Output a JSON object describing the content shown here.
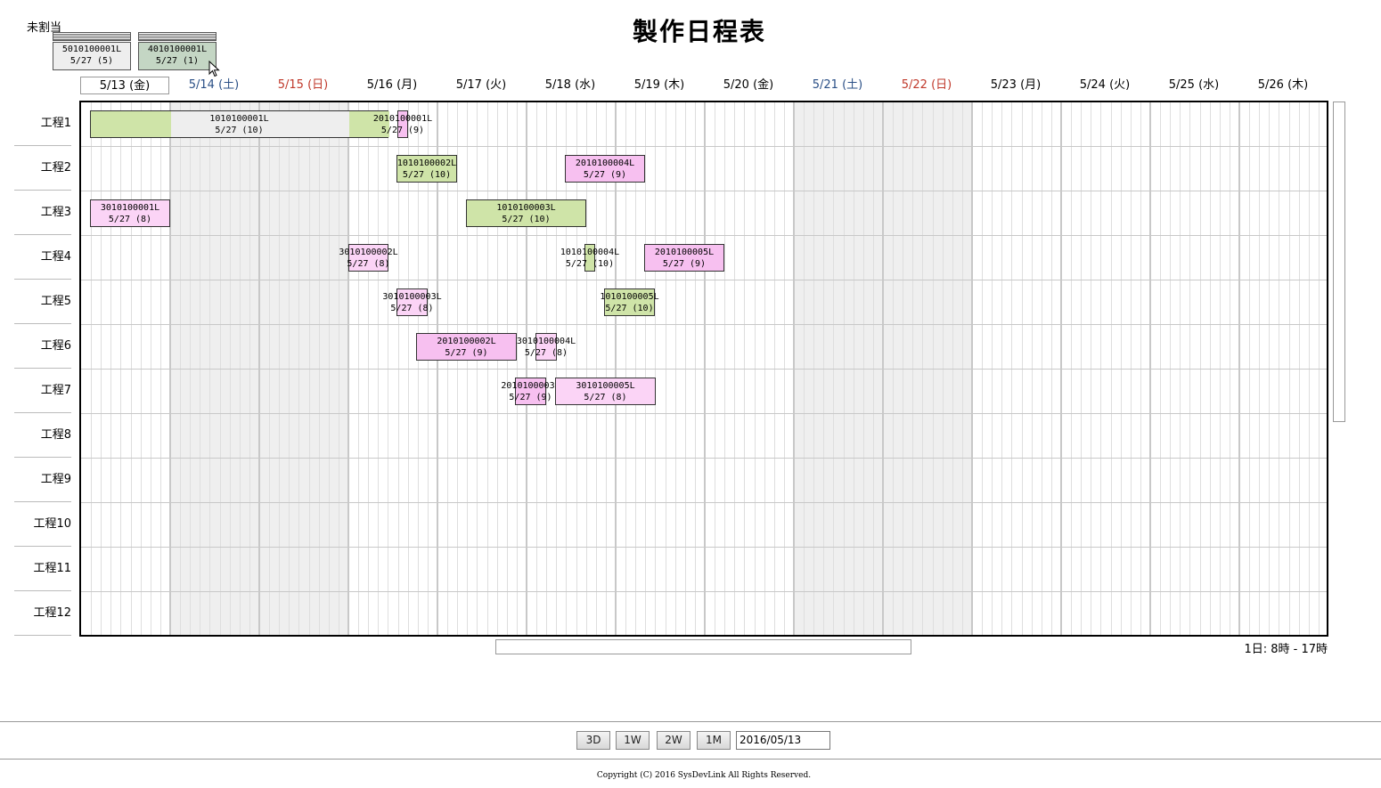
{
  "title": "製作日程表",
  "unassigned": {
    "label": "未割当",
    "cards": [
      {
        "id": "5010100001L",
        "date": "5/27 (5)",
        "color": "#eeeeee"
      },
      {
        "id": "4010100001L",
        "date": "5/27 (1)",
        "color": "#c4d6c4"
      }
    ]
  },
  "days": [
    {
      "label": "5/13 (金)",
      "color": "#000000",
      "selected": true
    },
    {
      "label": "5/14 (土)",
      "color": "#2a4f86"
    },
    {
      "label": "5/15 (日)",
      "color": "#c0392b"
    },
    {
      "label": "5/16 (月)",
      "color": "#000000"
    },
    {
      "label": "5/17 (火)",
      "color": "#000000"
    },
    {
      "label": "5/18 (水)",
      "color": "#000000"
    },
    {
      "label": "5/19 (木)",
      "color": "#000000"
    },
    {
      "label": "5/20 (金)",
      "color": "#000000"
    },
    {
      "label": "5/21 (土)",
      "color": "#2a4f86"
    },
    {
      "label": "5/22 (日)",
      "color": "#c0392b"
    },
    {
      "label": "5/23 (月)",
      "color": "#000000"
    },
    {
      "label": "5/24 (火)",
      "color": "#000000"
    },
    {
      "label": "5/25 (水)",
      "color": "#000000"
    },
    {
      "label": "5/26 (木)",
      "color": "#000000"
    }
  ],
  "rows": [
    "工程1",
    "工程2",
    "工程3",
    "工程4",
    "工程5",
    "工程6",
    "工程7",
    "工程8",
    "工程9",
    "工程10",
    "工程11",
    "工程12"
  ],
  "jobs": [
    {
      "row": 0,
      "id": "1010100001L",
      "date": "5/27 (10)",
      "start": 0.1,
      "duration": 3.35,
      "color": "grey",
      "progress_segments": [
        [
          0,
          0.9
        ],
        [
          2.9,
          3.35
        ]
      ]
    },
    {
      "row": 0,
      "id": "2010100001L",
      "date": "5/27 (9)",
      "start": 3.55,
      "duration": 0.12,
      "color": "pink"
    },
    {
      "row": 1,
      "id": "1010100002L",
      "date": "5/27 (10)",
      "start": 3.54,
      "duration": 0.68,
      "color": "green"
    },
    {
      "row": 1,
      "id": "2010100004L",
      "date": "5/27 (9)",
      "start": 5.43,
      "duration": 0.9,
      "color": "pink"
    },
    {
      "row": 2,
      "id": "3010100001L",
      "date": "5/27 (8)",
      "start": 0.1,
      "duration": 0.9,
      "color": "pink2"
    },
    {
      "row": 2,
      "id": "1010100003L",
      "date": "5/27 (10)",
      "start": 4.32,
      "duration": 1.35,
      "color": "green"
    },
    {
      "row": 3,
      "id": "3010100002L",
      "date": "5/27 (8)",
      "start": 3.0,
      "duration": 0.45,
      "color": "pink2"
    },
    {
      "row": 3,
      "id": "1010100004L",
      "date": "5/27 (10)",
      "start": 5.65,
      "duration": 0.12,
      "color": "green"
    },
    {
      "row": 3,
      "id": "2010100005L",
      "date": "5/27 (9)",
      "start": 6.32,
      "duration": 0.9,
      "color": "pink"
    },
    {
      "row": 4,
      "id": "3010100003L",
      "date": "5/27 (8)",
      "start": 3.54,
      "duration": 0.35,
      "color": "pink2"
    },
    {
      "row": 4,
      "id": "1010100005L",
      "date": "5/27 (10)",
      "start": 5.87,
      "duration": 0.57,
      "color": "green"
    },
    {
      "row": 5,
      "id": "2010100002L",
      "date": "5/27 (9)",
      "start": 3.76,
      "duration": 1.13,
      "color": "pink"
    },
    {
      "row": 5,
      "id": "3010100004L",
      "date": "5/27 (8)",
      "start": 5.1,
      "duration": 0.24,
      "color": "pink2"
    },
    {
      "row": 6,
      "id": "2010100003L",
      "date": "5/27 (9)",
      "start": 4.87,
      "duration": 0.35,
      "color": "pink"
    },
    {
      "row": 6,
      "id": "3010100005L",
      "date": "5/27 (8)",
      "start": 5.32,
      "duration": 1.13,
      "color": "pink2"
    }
  ],
  "hours_note": "1日: 8時 - 17時",
  "toolbar": {
    "buttons": [
      "3D",
      "1W",
      "2W",
      "1M"
    ],
    "date_value": "2016/05/13"
  },
  "copyright": "Copyright (C) 2016 SysDevLink All Rights Reserved.",
  "colors": {
    "green": "#cfe4a8",
    "pink": "#f7c0f0",
    "pink2": "#fbd4f6",
    "grey": "#eeeeee",
    "weekend_bg": "#efefef"
  }
}
